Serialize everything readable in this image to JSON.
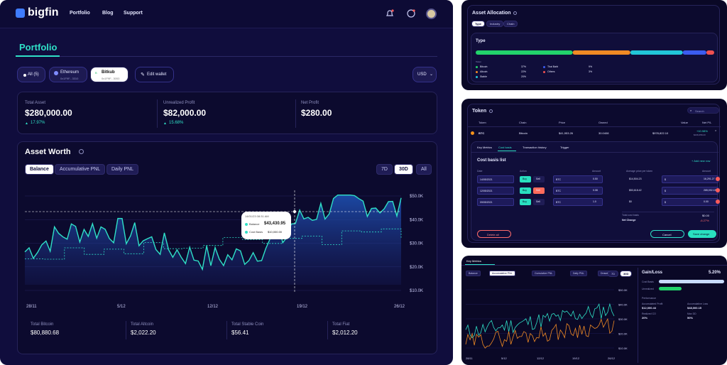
{
  "nav": {
    "logo": "bigfin",
    "links": [
      "Portfolio",
      "Blog",
      "Support"
    ]
  },
  "page": {
    "title": "Portfolio"
  },
  "wallets": {
    "all": "All (5)",
    "w1": {
      "name": "Ethereum",
      "addr": "0x1F9F...3310"
    },
    "w2": {
      "name": "Bitkub",
      "addr": "0x1F9F...3053"
    },
    "edit": "Edit wallet",
    "currency": "USD"
  },
  "summary": [
    {
      "label": "Total Asset",
      "value": "$280,000.00",
      "change": "17.97%"
    },
    {
      "label": "Unrealized Profit",
      "value": "$82,000.00",
      "change": "15.68%"
    },
    {
      "label": "Net Profit",
      "value": "$280.00",
      "change": ""
    }
  ],
  "worth": {
    "title": "Asset Worth",
    "tabs": [
      "Balance",
      "Accumulative PNL",
      "Daily PNL"
    ],
    "ranges": [
      "7D",
      "30D",
      "All"
    ],
    "yticks": [
      "$50.0K",
      "$40.0K",
      "$30.0K",
      "$20.0K",
      "$10.0K"
    ],
    "xticks": [
      "28/11",
      "5/12",
      "12/12",
      "19/12",
      "26/12"
    ],
    "tooltip": {
      "date": "14/01/23 08:31 AM",
      "balance_label": "Balance",
      "balance": "$43,430.95",
      "cost_label": "Cost Basis",
      "cost": "$10,000.00"
    }
  },
  "totals": [
    {
      "label": "Total Bitcoin",
      "value": "$80,880.68"
    },
    {
      "label": "Total Altcoin",
      "value": "$2,022.20"
    },
    {
      "label": "Total Stable Coin",
      "value": "$56.41"
    },
    {
      "label": "Total Fiat",
      "value": "$2,012.20"
    }
  ],
  "allocation": {
    "title": "Asset Allocation",
    "tabs": [
      "Type",
      "Industry",
      "Chain"
    ],
    "subtitle": "Type",
    "legend_head": "Token",
    "items": [
      {
        "name": "Bitcoin",
        "pct": "37%",
        "color": "#22d36b"
      },
      {
        "name": "Altcoin",
        "pct": "22%",
        "color": "#f08a24"
      },
      {
        "name": "Stable",
        "pct": "20%",
        "color": "#21c6d8"
      },
      {
        "name": "Thai Baht",
        "pct": "9%",
        "color": "#3b5cf0"
      },
      {
        "name": "Others",
        "pct": "3%",
        "color": "#f05050"
      }
    ]
  },
  "token": {
    "title": "Token",
    "search": "Search",
    "cols": [
      "Token",
      "Chain",
      "Price",
      "Owned",
      "Value",
      "Net P/L"
    ],
    "row": {
      "symbol": "BTC",
      "chain": "Bitcoin",
      "price": "$41,953.26",
      "owned": "30.0408",
      "value": "$978,822.10",
      "pnl": "+10.98%",
      "pnl2": "$236,058.23"
    },
    "tabs": [
      "Key Metrics",
      "Cost basis",
      "Transaction history",
      "Trigger"
    ],
    "cb_title": "Cost basis list",
    "add": "+ Add new row",
    "cb_cols": [
      "Date",
      "Action",
      "Amount",
      "Average price per token",
      "Amount"
    ],
    "cb_rows": [
      {
        "date": "14/05/2021",
        "unit": "BTC",
        "amt": "0.50",
        "avg": "$14,504.23",
        "total": "16,291.27"
      },
      {
        "date": "12/05/2021",
        "unit": "BTC",
        "amt": "0.08",
        "avg": "$53,618.42",
        "total": "265,092.15"
      },
      {
        "date": "09/05/2021",
        "unit": "BTC",
        "amt": "1.0",
        "avg": "$0",
        "total": "0.00"
      }
    ],
    "buy": "Buy",
    "sell": "Sell",
    "total_label": "Total cost basis",
    "total": "$0.00",
    "change_label": "Net Change",
    "change": "-6.27%",
    "delete": "Delete all",
    "cancel": "Cancel",
    "save": "Save change"
  },
  "metrics": {
    "tab": "Key Metrics",
    "tabs": [
      "Balance",
      "Accumulative PNL",
      "Cumulative PNL",
      "Daily PNL",
      "Drawdown"
    ],
    "ranges": [
      "7D",
      "30D"
    ],
    "yticks": [
      "$50.0K",
      "$40.0K",
      "$30.0K",
      "$20.0K",
      "$10.0K"
    ],
    "xticks": [
      "28/11",
      "5/12",
      "12/12",
      "19/12",
      "26/12"
    ],
    "gain_label": "Gain/Loss",
    "gain": "5.20%",
    "cost_label": "Cost Basis",
    "unreal_label": "Unrealized",
    "perf_label": "Performance",
    "stats": [
      {
        "label": "Accumulated Profit",
        "value": "$12,000.44"
      },
      {
        "label": "Accumulative Loss",
        "value": "$48,000.15"
      },
      {
        "label": "Realized CO",
        "value": "20%"
      },
      {
        "label": "Max DD",
        "value": "50%"
      }
    ]
  }
}
